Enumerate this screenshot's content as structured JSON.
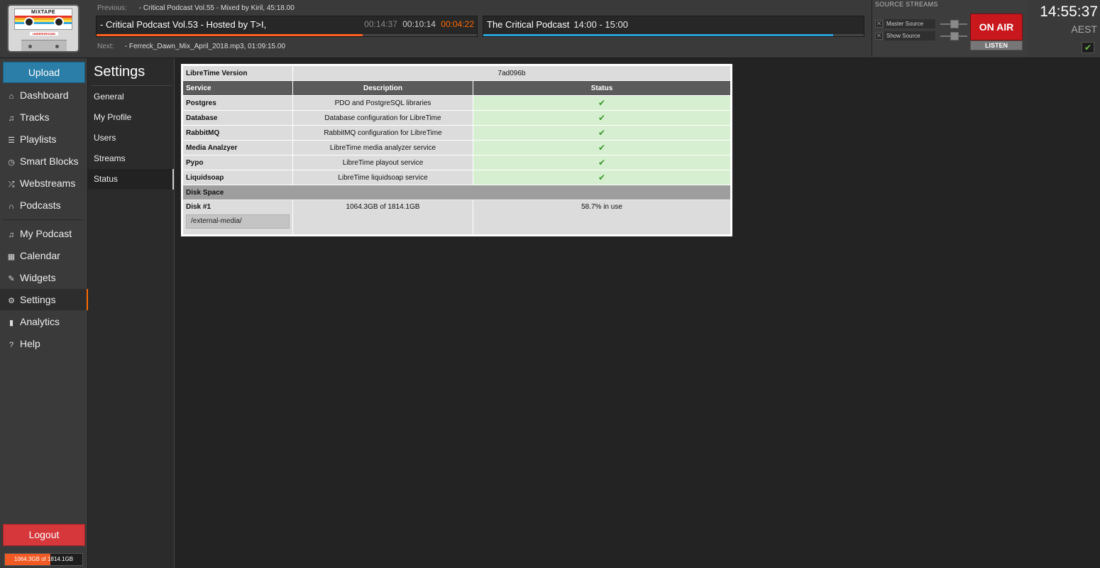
{
  "logo": {
    "title": "MIXTAPE",
    "subtitle": "UNDERGROUND"
  },
  "player": {
    "previous_label": "Previous:",
    "previous_value": "- Critical Podcast Vol.55 - Mixed by Kiril, 45:18.00",
    "current_title": "- Critical Podcast Vol.53 - Hosted by T>I,",
    "elapsed": "00:14:37",
    "total": "00:10:14",
    "remaining": "00:04:22",
    "current_progress_pct": 70,
    "next_label": "Next:",
    "next_value": "- Ferreck_Dawn_Mix_April_2018.mp3, 01:09:15.00",
    "show_title": "The Critical Podcast",
    "show_time": "14:00 - 15:00",
    "show_progress_pct": 92
  },
  "source_streams": {
    "title": "SOURCE STREAMS",
    "master": "Master Source",
    "show": "Show Source",
    "on_air": "ON AIR",
    "listen": "LISTEN"
  },
  "clock": {
    "time": "14:55:37",
    "timezone": "AEST"
  },
  "nav": {
    "upload": "Upload",
    "items": [
      {
        "label": "Dashboard",
        "icon": "home-icon"
      },
      {
        "label": "Tracks",
        "icon": "music-icon"
      },
      {
        "label": "Playlists",
        "icon": "list-icon"
      },
      {
        "label": "Smart Blocks",
        "icon": "clock-icon"
      },
      {
        "label": "Webstreams",
        "icon": "shuffle-icon"
      },
      {
        "label": "Podcasts",
        "icon": "headphones-icon"
      },
      {
        "label": "My Podcast",
        "icon": "music-icon"
      },
      {
        "label": "Calendar",
        "icon": "calendar-icon"
      },
      {
        "label": "Widgets",
        "icon": "wrench-icon"
      },
      {
        "label": "Settings",
        "icon": "gear-icon"
      },
      {
        "label": "Analytics",
        "icon": "bar-chart-icon"
      },
      {
        "label": "Help",
        "icon": "help-icon"
      }
    ],
    "logout": "Logout",
    "disk_usage": "1064.3GB of 1814.1GB",
    "disk_pct": 58.7
  },
  "settings": {
    "title": "Settings",
    "items": [
      "General",
      "My Profile",
      "Users",
      "Streams",
      "Status"
    ]
  },
  "status": {
    "version_label": "LibreTime Version",
    "version_value": "7ad096b",
    "headers": [
      "Service",
      "Description",
      "Status"
    ],
    "services": [
      {
        "name": "Postgres",
        "description": "PDO and PostgreSQL libraries"
      },
      {
        "name": "Database",
        "description": "Database configuration for LibreTime"
      },
      {
        "name": "RabbitMQ",
        "description": "RabbitMQ configuration for LibreTime"
      },
      {
        "name": "Media Analzyer",
        "description": "LibreTime media analyzer service"
      },
      {
        "name": "Pypo",
        "description": "LibreTime playout service"
      },
      {
        "name": "Liquidsoap",
        "description": "LibreTime liquidsoap service"
      }
    ],
    "disk_section": "Disk Space",
    "disk_name": "Disk #1",
    "disk_path": "/external-media/",
    "disk_size": "1064.3GB of 1814.1GB",
    "disk_pct": "58.7% in use"
  },
  "colors": {
    "accent": "#ff6a00",
    "upload": "#2a7ea8",
    "logout": "#d6373b",
    "on_air": "#c8181e",
    "ok": "#3a9a2a"
  }
}
